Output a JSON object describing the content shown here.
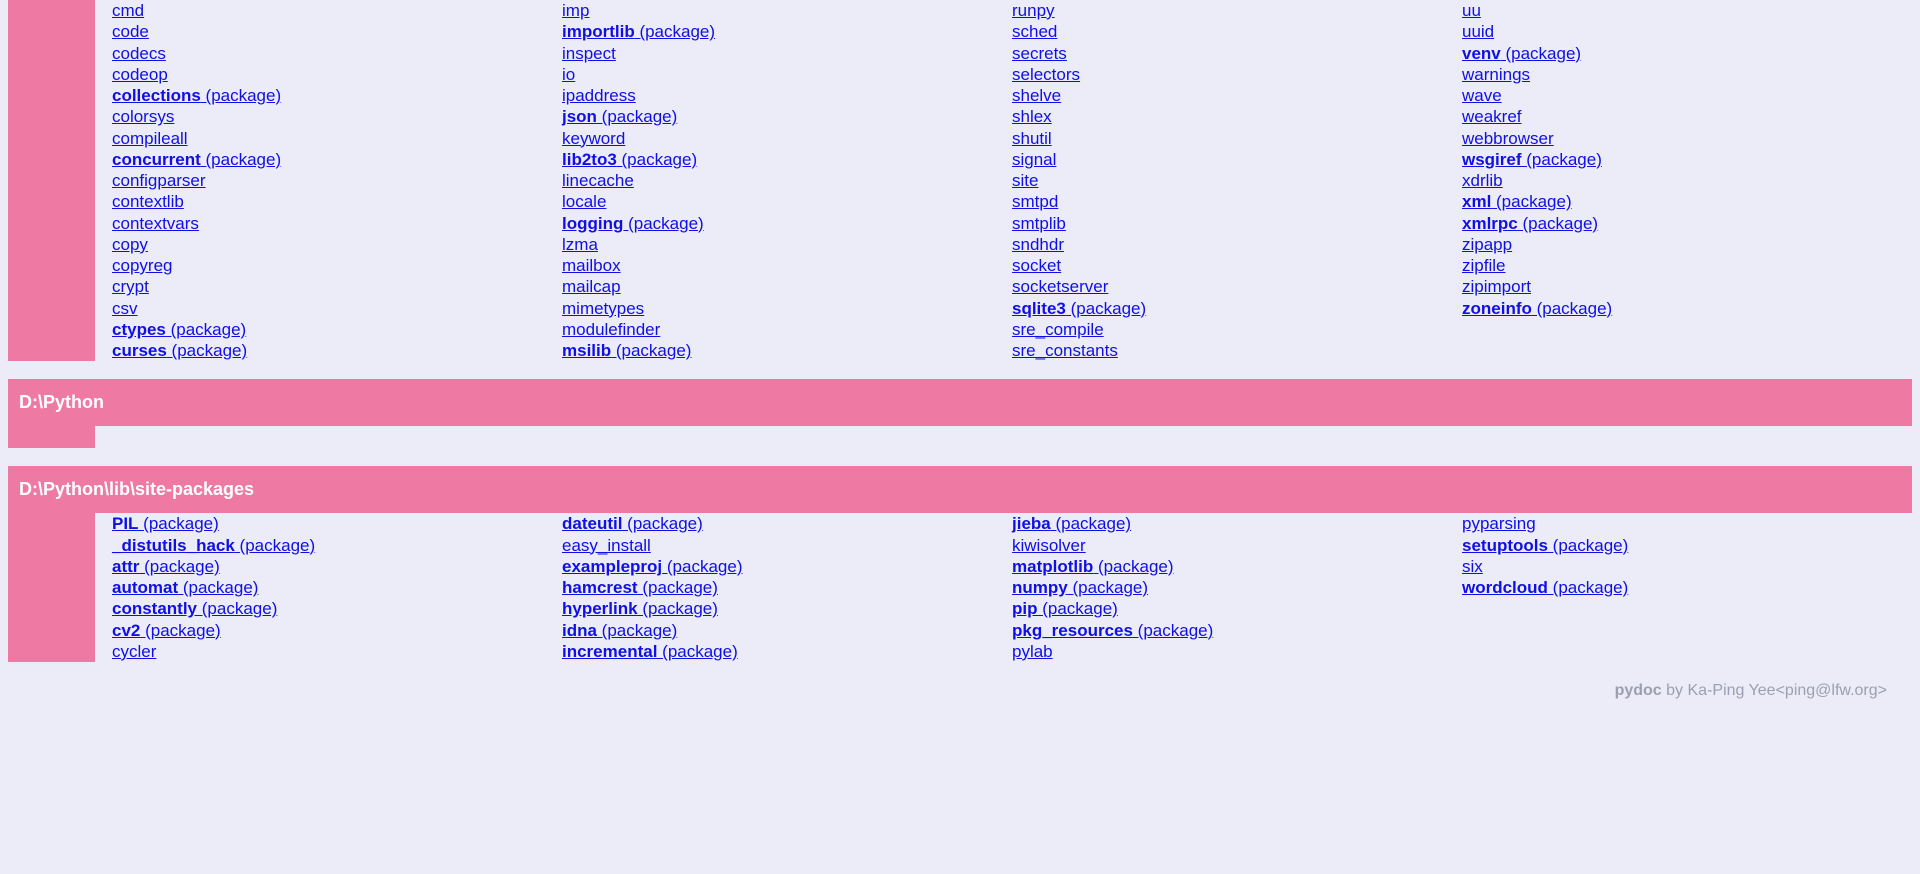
{
  "stdlib": {
    "col1": [
      {
        "name": "cmd"
      },
      {
        "name": "code"
      },
      {
        "name": "codecs"
      },
      {
        "name": "codeop"
      },
      {
        "name": "collections",
        "pkg": true
      },
      {
        "name": "colorsys"
      },
      {
        "name": "compileall"
      },
      {
        "name": "concurrent",
        "pkg": true
      },
      {
        "name": "configparser"
      },
      {
        "name": "contextlib"
      },
      {
        "name": "contextvars"
      },
      {
        "name": "copy"
      },
      {
        "name": "copyreg"
      },
      {
        "name": "crypt"
      },
      {
        "name": "csv"
      },
      {
        "name": "ctypes",
        "pkg": true
      },
      {
        "name": "curses",
        "pkg": true
      }
    ],
    "col2": [
      {
        "name": "imp"
      },
      {
        "name": "importlib",
        "pkg": true
      },
      {
        "name": "inspect"
      },
      {
        "name": "io"
      },
      {
        "name": "ipaddress"
      },
      {
        "name": "json",
        "pkg": true
      },
      {
        "name": "keyword"
      },
      {
        "name": "lib2to3",
        "pkg": true
      },
      {
        "name": "linecache"
      },
      {
        "name": "locale"
      },
      {
        "name": "logging",
        "pkg": true
      },
      {
        "name": "lzma"
      },
      {
        "name": "mailbox"
      },
      {
        "name": "mailcap"
      },
      {
        "name": "mimetypes"
      },
      {
        "name": "modulefinder"
      },
      {
        "name": "msilib",
        "pkg": true
      }
    ],
    "col3": [
      {
        "name": "runpy"
      },
      {
        "name": "sched"
      },
      {
        "name": "secrets"
      },
      {
        "name": "selectors"
      },
      {
        "name": "shelve"
      },
      {
        "name": "shlex"
      },
      {
        "name": "shutil"
      },
      {
        "name": "signal"
      },
      {
        "name": "site"
      },
      {
        "name": "smtpd"
      },
      {
        "name": "smtplib"
      },
      {
        "name": "sndhdr"
      },
      {
        "name": "socket"
      },
      {
        "name": "socketserver"
      },
      {
        "name": "sqlite3",
        "pkg": true
      },
      {
        "name": "sre_compile"
      },
      {
        "name": "sre_constants"
      }
    ],
    "col4": [
      {
        "name": "uu"
      },
      {
        "name": "uuid"
      },
      {
        "name": "venv",
        "pkg": true
      },
      {
        "name": "warnings"
      },
      {
        "name": "wave"
      },
      {
        "name": "weakref"
      },
      {
        "name": "webbrowser"
      },
      {
        "name": "wsgiref",
        "pkg": true
      },
      {
        "name": "xdrlib"
      },
      {
        "name": "xml",
        "pkg": true
      },
      {
        "name": "xmlrpc",
        "pkg": true
      },
      {
        "name": "zipapp"
      },
      {
        "name": "zipfile"
      },
      {
        "name": "zipimport"
      },
      {
        "name": "zoneinfo",
        "pkg": true
      }
    ]
  },
  "sections": {
    "dpython": "D:\\Python",
    "sitepackages": "D:\\Python\\lib\\site-packages"
  },
  "sitepackages": {
    "col1": [
      {
        "name": "PIL",
        "pkg": true
      },
      {
        "name": "_distutils_hack",
        "pkg": true
      },
      {
        "name": "attr",
        "pkg": true
      },
      {
        "name": "automat",
        "pkg": true
      },
      {
        "name": "constantly",
        "pkg": true
      },
      {
        "name": "cv2",
        "pkg": true
      },
      {
        "name": "cycler"
      }
    ],
    "col2": [
      {
        "name": "dateutil",
        "pkg": true
      },
      {
        "name": "easy_install"
      },
      {
        "name": "exampleproj",
        "pkg": true
      },
      {
        "name": "hamcrest",
        "pkg": true
      },
      {
        "name": "hyperlink",
        "pkg": true
      },
      {
        "name": "idna",
        "pkg": true
      },
      {
        "name": "incremental",
        "pkg": true
      }
    ],
    "col3": [
      {
        "name": "jieba",
        "pkg": true
      },
      {
        "name": "kiwisolver"
      },
      {
        "name": "matplotlib",
        "pkg": true
      },
      {
        "name": "numpy",
        "pkg": true
      },
      {
        "name": "pip",
        "pkg": true
      },
      {
        "name": "pkg_resources",
        "pkg": true
      },
      {
        "name": "pylab"
      }
    ],
    "col4": [
      {
        "name": "pyparsing"
      },
      {
        "name": "setuptools",
        "pkg": true
      },
      {
        "name": "six"
      },
      {
        "name": "wordcloud",
        "pkg": true
      }
    ]
  },
  "footer": {
    "tool": "pydoc",
    "by": " by Ka-Ping Yee",
    "email": "<ping@lfw.org>"
  },
  "package_suffix": " (package)"
}
